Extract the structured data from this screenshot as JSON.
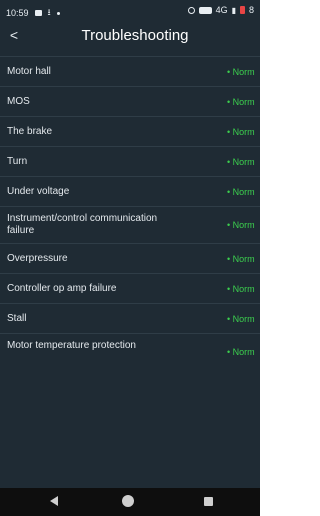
{
  "status_bar": {
    "time": "10:59",
    "network": "4G",
    "battery": "8"
  },
  "header": {
    "title": "Troubleshooting"
  },
  "rows": [
    {
      "label": "Motor hall",
      "status": "• Norm"
    },
    {
      "label": "MOS",
      "status": "• Norm"
    },
    {
      "label": "The brake",
      "status": "• Norm"
    },
    {
      "label": "Turn",
      "status": "• Norm"
    },
    {
      "label": "Under voltage",
      "status": "• Norm"
    },
    {
      "label": "Instrument/control communication failure",
      "status": "• Norm"
    },
    {
      "label": "Overpressure",
      "status": "• Norm"
    },
    {
      "label": "Controller op amp failure",
      "status": "• Norm"
    },
    {
      "label": "Stall",
      "status": "• Norm"
    },
    {
      "label": "Motor temperature protection",
      "status": "• Norm"
    }
  ],
  "colors": {
    "background": "#1f2b34",
    "status_ok": "#3ccf4e",
    "text": "#e4e9ed"
  }
}
